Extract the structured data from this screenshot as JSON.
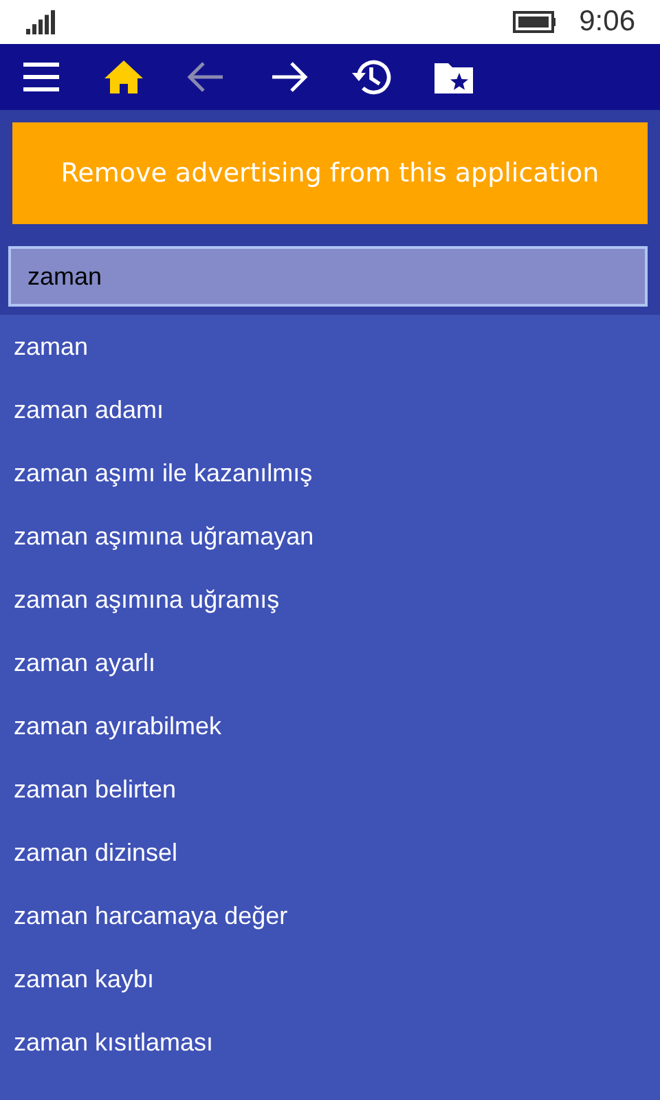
{
  "status_bar": {
    "time": "9:06"
  },
  "toolbar": [
    {
      "kind": "menu",
      "selected": false,
      "disabled": false
    },
    {
      "kind": "home",
      "selected": true,
      "disabled": false
    },
    {
      "kind": "back",
      "selected": false,
      "disabled": true
    },
    {
      "kind": "forward",
      "selected": false,
      "disabled": false
    },
    {
      "kind": "history",
      "selected": false,
      "disabled": false
    },
    {
      "kind": "favorites",
      "selected": false,
      "disabled": false
    }
  ],
  "ad_button": "Remove advertising from this application",
  "search": {
    "value": "zaman"
  },
  "results": [
    "zaman",
    "zaman adamı",
    "zaman aşımı ile kazanılmış",
    "zaman aşımına uğramayan",
    "zaman aşımına uğramış",
    "zaman ayarlı",
    "zaman ayırabilmek",
    "zaman belirten",
    "zaman dizinsel",
    "zaman harcamaya değer",
    "zaman kaybı",
    "zaman kısıtlaması"
  ]
}
